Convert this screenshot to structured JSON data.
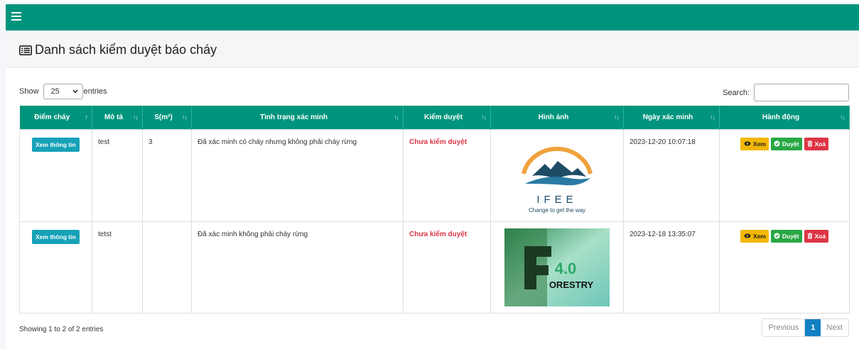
{
  "page": {
    "title": "Danh sách kiểm duyệt báo cháy"
  },
  "controls": {
    "show_label": "Show",
    "entries_value": "25",
    "entries_label": "entries",
    "search_label": "Search:",
    "search_value": ""
  },
  "table": {
    "headers": [
      "Điểm cháy",
      "Mô tả",
      "S(m²)",
      "Tình trạng xác minh",
      "Kiểm duyệt",
      "Hình ảnh",
      "Ngày xác minh",
      "Hành động"
    ],
    "rows": [
      {
        "point_button": "Xem thông tin",
        "description": "test",
        "area": "3",
        "verification": "Đã xác minh có cháy nhưng không phải cháy rừng",
        "moderation": "Chưa kiểm duyệt",
        "image_text_1": "IFEE",
        "image_text_2": "Change to get the way",
        "date": "2023-12-20 10:07:18"
      },
      {
        "point_button": "Xem thông tin",
        "description": "tetst",
        "area": "",
        "verification": "Đã xác minh không phải cháy rừng",
        "moderation": "Chưa kiểm duyệt",
        "image_text_1": "4.0",
        "image_text_2": "ORESTRY",
        "date": "2023-12-18 13:35:07"
      }
    ],
    "actions": {
      "view": "Xem",
      "approve": "Duyệt",
      "delete": "Xoá"
    }
  },
  "footer": {
    "info": "Showing 1 to 2 of 2 entries",
    "prev": "Previous",
    "page": "1",
    "next": "Next"
  },
  "colors": {
    "brand": "#00947d",
    "info": "#17a2b8",
    "danger": "#dc3545",
    "success": "#28a745",
    "warning": "#f2b705"
  }
}
